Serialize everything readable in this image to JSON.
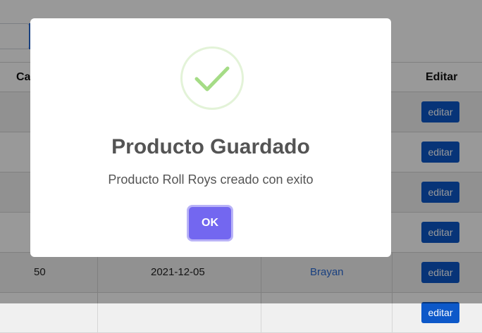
{
  "table": {
    "headers": {
      "cantidad": "Ca",
      "editar": "Editar"
    },
    "rows": [
      {
        "cantidad": "",
        "fecha": "",
        "usuario": "",
        "edit_label": "editar"
      },
      {
        "cantidad": "",
        "fecha": "",
        "usuario": "",
        "edit_label": "editar"
      },
      {
        "cantidad": "",
        "fecha": "",
        "usuario": "",
        "edit_label": "editar"
      },
      {
        "cantidad": "",
        "fecha": "",
        "usuario": "",
        "edit_label": "editar"
      },
      {
        "cantidad": "50",
        "fecha": "2021-12-05",
        "usuario": "Brayan",
        "edit_label": "editar"
      },
      {
        "cantidad": "",
        "fecha": "",
        "usuario": "",
        "edit_label": "editar"
      }
    ]
  },
  "modal": {
    "icon": "success-check-icon",
    "title": "Producto Guardado",
    "text": "Producto Roll Roys creado con exito",
    "ok_label": "OK"
  },
  "colors": {
    "confirm_button": "#7367f0",
    "edit_button": "#0d58c9",
    "success_check": "#a5dc86",
    "link": "#2b6bd6"
  }
}
